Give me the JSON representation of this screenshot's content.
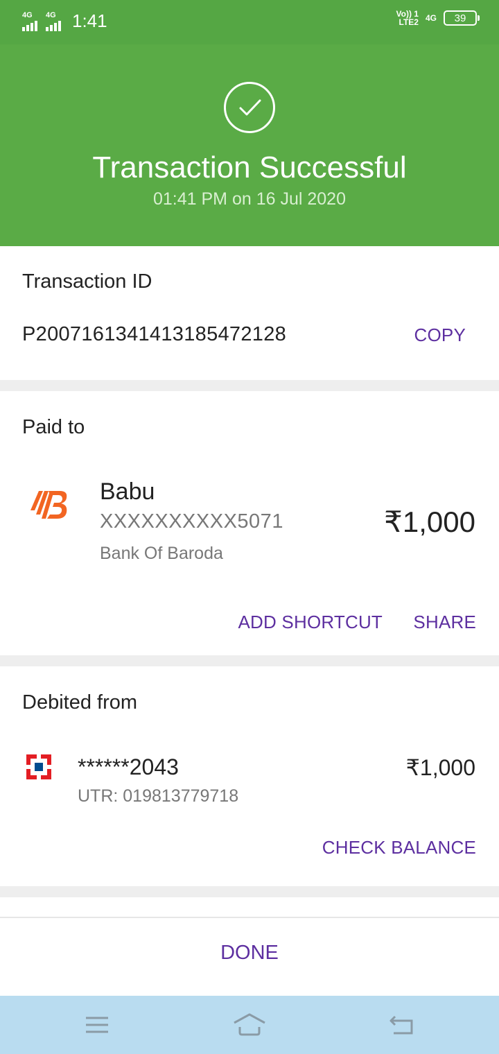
{
  "status_bar": {
    "sim1_label": "4G",
    "sim2_label": "4G",
    "time": "1:41",
    "volte_top": "Vo)) 1",
    "volte_bottom": "LTE2",
    "network": "4G",
    "battery": "39"
  },
  "header": {
    "title": "Transaction Successful",
    "subtitle": "01:41 PM on 16 Jul 2020"
  },
  "transaction": {
    "label": "Transaction ID",
    "id": "P2007161341413185472128",
    "copy_label": "COPY"
  },
  "paid_to": {
    "label": "Paid to",
    "name": "Babu",
    "account": "XXXXXXXXXX5071",
    "bank": "Bank Of Baroda",
    "amount": "₹1,000",
    "add_shortcut_label": "ADD SHORTCUT",
    "share_label": "SHARE",
    "bank_icon": "bank-of-baroda-logo"
  },
  "debited_from": {
    "label": "Debited from",
    "account": "******2043",
    "utr": "UTR: 019813779718",
    "amount": "₹1,000",
    "check_balance_label": "CHECK BALANCE",
    "bank_icon": "hdfc-logo"
  },
  "footer": {
    "done_label": "DONE"
  },
  "colors": {
    "success_green": "#5aab46",
    "accent_purple": "#5d2fa0",
    "nav_bar": "#b9dcf0"
  }
}
